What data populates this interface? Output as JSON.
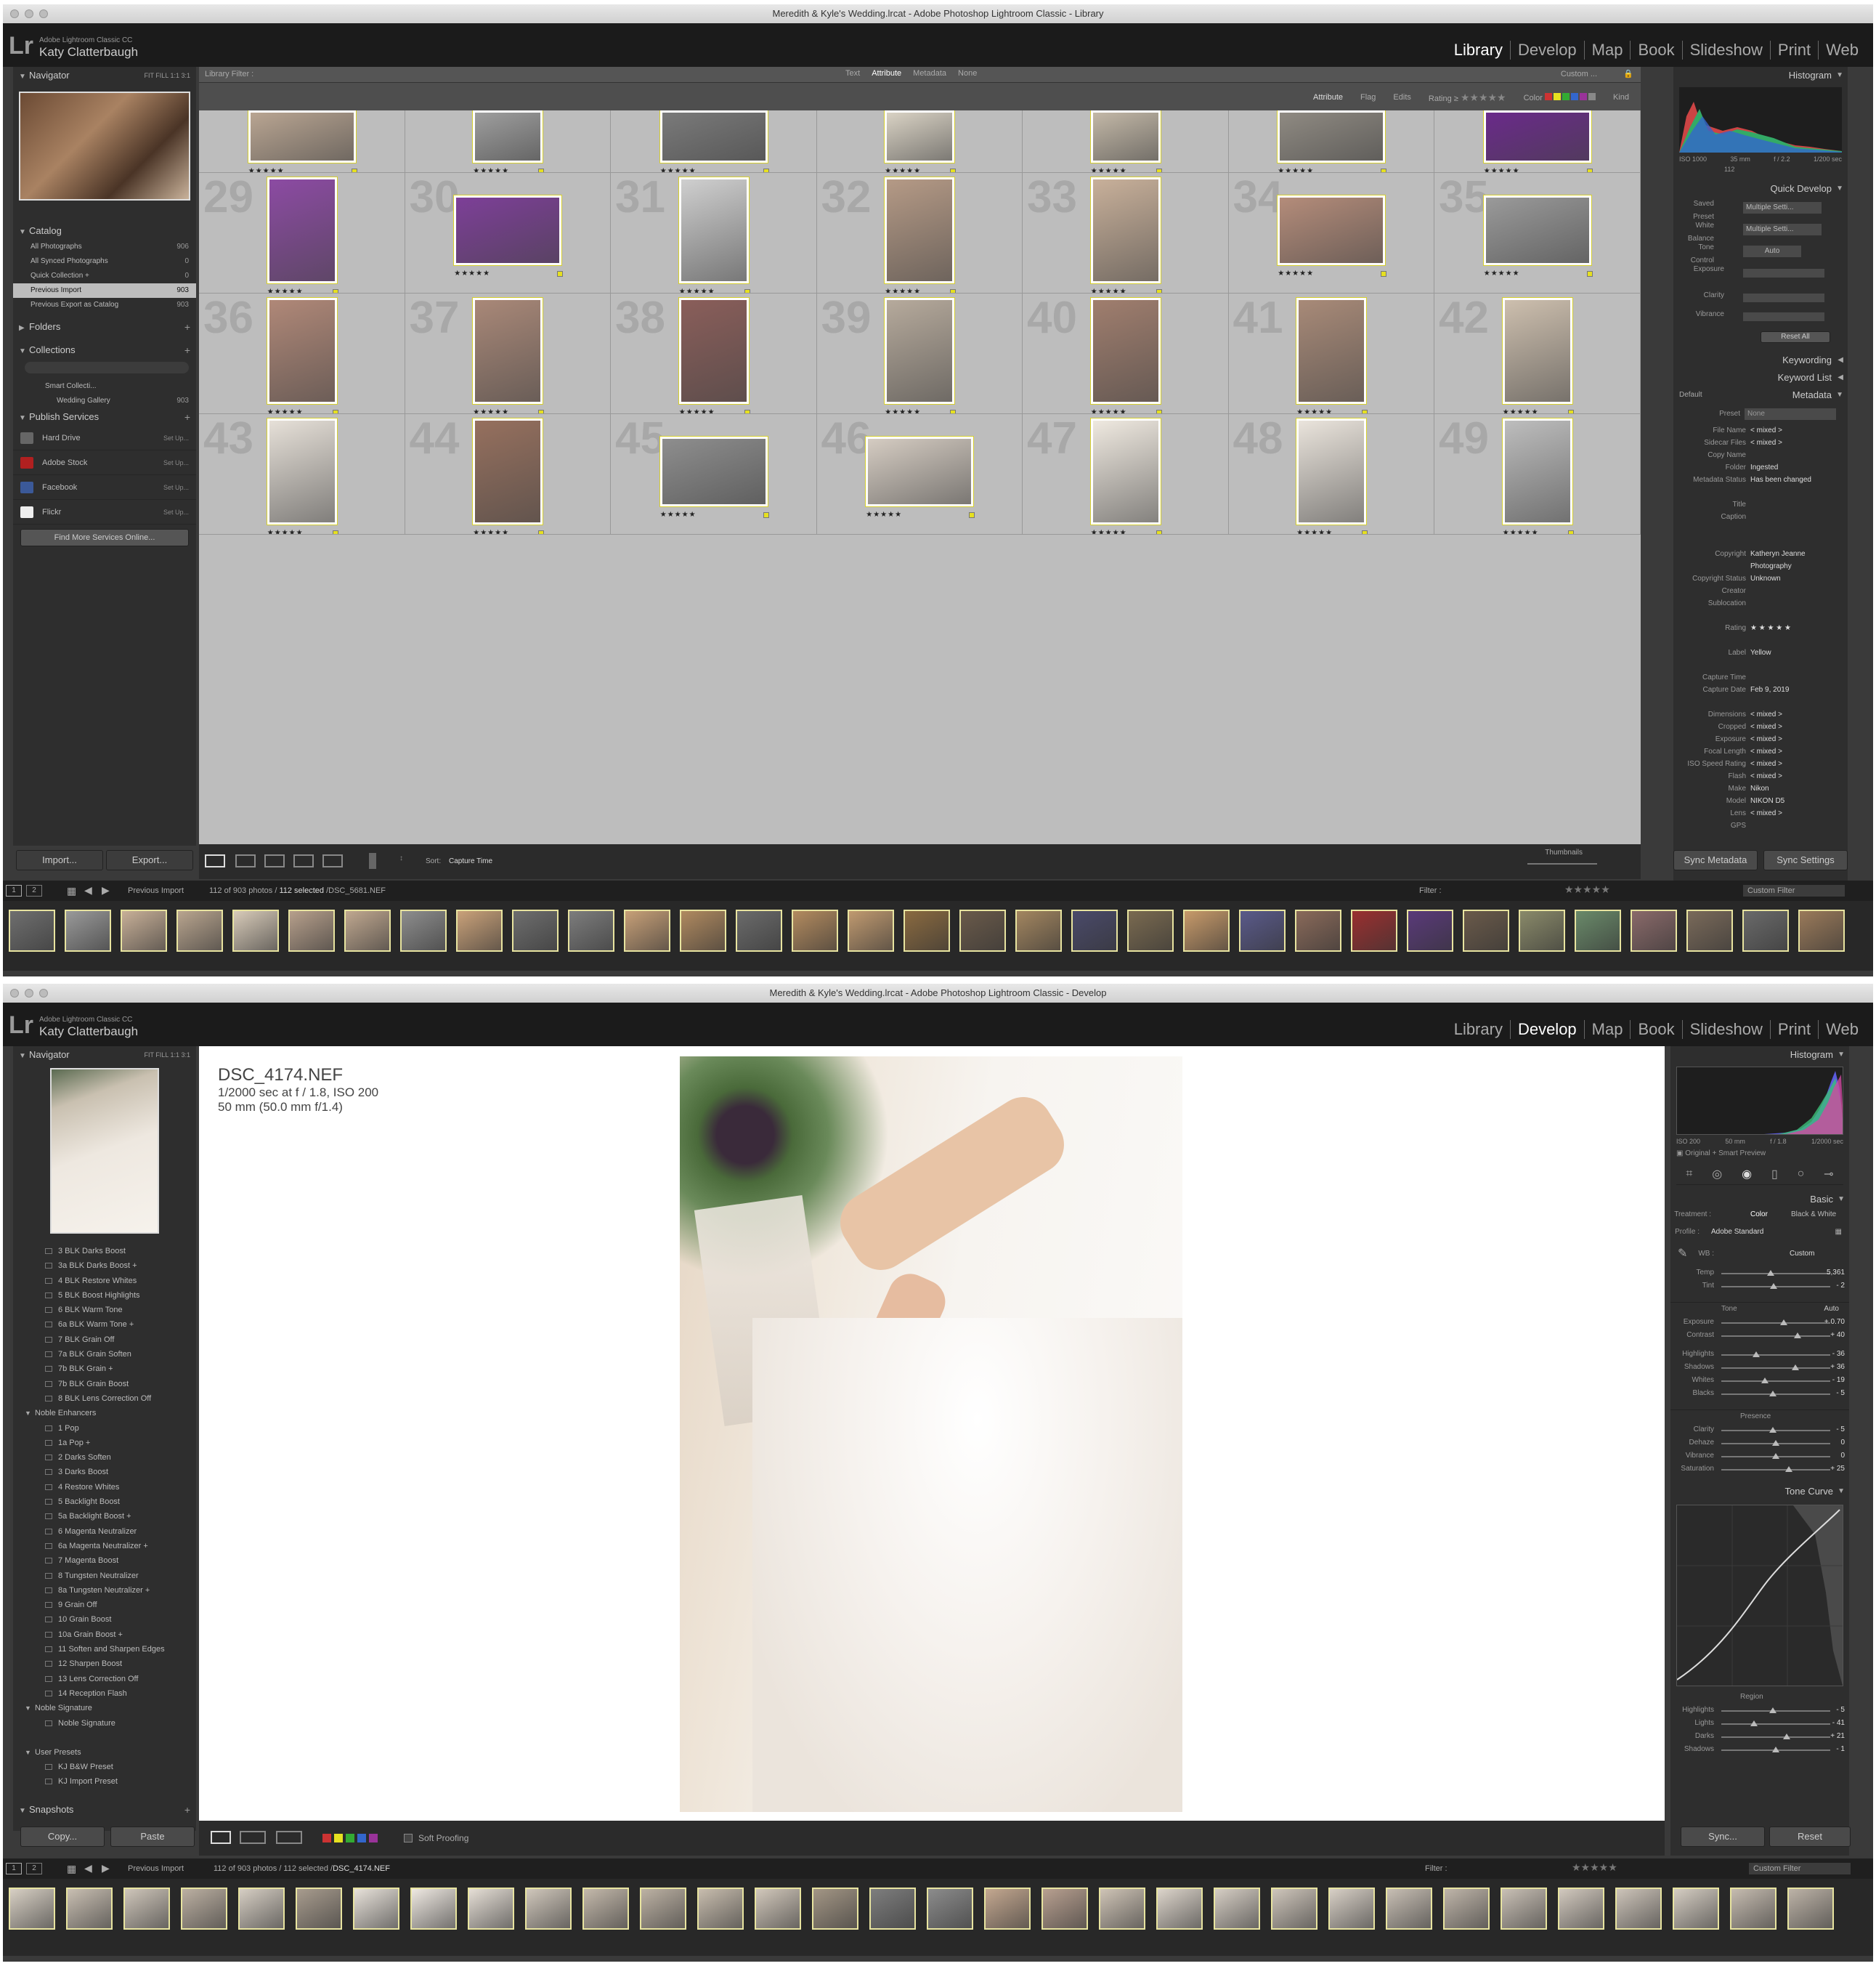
{
  "library": {
    "window_title": "Meredith & Kyle's Wedding.lrcat - Adobe Photoshop Lightroom Classic - Library",
    "brand_small": "Adobe Lightroom Classic CC",
    "brand_name": "Katy Clatterbaugh",
    "modules": [
      "Library",
      "Develop",
      "Map",
      "Book",
      "Slideshow",
      "Print",
      "Web"
    ],
    "active_module": "Library",
    "navigator": {
      "title": "Navigator",
      "zoom": "FIT  FILL  1:1  3:1"
    },
    "catalog": {
      "title": "Catalog",
      "items": [
        {
          "label": "All Photographs",
          "count": "906"
        },
        {
          "label": "All Synced Photographs",
          "count": "0"
        },
        {
          "label": "Quick Collection +",
          "count": "0"
        },
        {
          "label": "Previous Import",
          "count": "903"
        },
        {
          "label": "Previous Export as Catalog",
          "count": "903"
        }
      ]
    },
    "folders": "Folders",
    "collections": {
      "title": "Collections",
      "items": [
        "Smart Collecti...",
        "Wedding Gallery"
      ],
      "gallery_count": "903"
    },
    "publish": {
      "title": "Publish Services",
      "services": [
        {
          "label": "Hard Drive",
          "set": "Set Up...",
          "icon": "hard-drive-icon",
          "color": "#666666"
        },
        {
          "label": "Adobe Stock",
          "set": "Set Up...",
          "icon": "adobe-stock-icon",
          "color": "#b02020"
        },
        {
          "label": "Facebook",
          "set": "Set Up...",
          "icon": "facebook-icon",
          "color": "#3b5998"
        },
        {
          "label": "Flickr",
          "set": "Set Up...",
          "icon": "flickr-icon",
          "color": "#eeeeee"
        }
      ],
      "find_more": "Find More Services Online..."
    },
    "import_btn": "Import...",
    "export_btn": "Export...",
    "filter_bar": {
      "label": "Library Filter :",
      "tabs": [
        "Text",
        "Attribute",
        "Metadata",
        "None"
      ],
      "custom": "Custom ...",
      "attr_label": "Attribute",
      "flag": "Flag",
      "edits": "Edits",
      "rating": "Rating",
      "color": "Color",
      "kind": "Kind"
    },
    "grid_cells": [
      {
        "n": "",
        "stars": "★★★★★",
        "tone": "#b9a592"
      },
      {
        "n": "",
        "stars": "★★★★★",
        "tone": "#9e9e9e"
      },
      {
        "n": "",
        "stars": "★★★★★",
        "tone": "#7a7a7a"
      },
      {
        "n": "",
        "stars": "★★★★★",
        "tone": "#d9d2c4"
      },
      {
        "n": "",
        "stars": "★★★★★",
        "tone": "#c3b8a7"
      },
      {
        "n": "",
        "stars": "★★★★★",
        "tone": "#8f8a82"
      },
      {
        "n": "",
        "stars": "★★★★★",
        "tone": "#6a2a8a"
      },
      {
        "n": "29",
        "stars": "★★★★★",
        "tone": "#8c4ba3"
      },
      {
        "n": "30",
        "stars": "★★★★★",
        "tone": "#7d3f98"
      },
      {
        "n": "31",
        "stars": "★★★★★",
        "tone": "#cfcfcf"
      },
      {
        "n": "32",
        "stars": "★★★★★",
        "tone": "#b59a86"
      },
      {
        "n": "33",
        "stars": "★★★★★",
        "tone": "#c8b09a"
      },
      {
        "n": "34",
        "stars": "★★★★★",
        "tone": "#b48c7a"
      },
      {
        "n": "35",
        "stars": "★★★★★",
        "tone": "#9a9a9a"
      },
      {
        "n": "36",
        "stars": "★★★★★",
        "tone": "#b08878"
      },
      {
        "n": "37",
        "stars": "★★★★★",
        "tone": "#a98878"
      },
      {
        "n": "38",
        "stars": "★★★★★",
        "tone": "#8a5e5a"
      },
      {
        "n": "39",
        "stars": "★★★★★",
        "tone": "#b6aa9c"
      },
      {
        "n": "40",
        "stars": "★★★★★",
        "tone": "#a07e6e"
      },
      {
        "n": "41",
        "stars": "★★★★★",
        "tone": "#a88a78"
      },
      {
        "n": "42",
        "stars": "★★★★★",
        "tone": "#cdbfae"
      },
      {
        "n": "43",
        "stars": "★★★★★",
        "tone": "#e6e0d8"
      },
      {
        "n": "44",
        "stars": "★★★★★",
        "tone": "#96705e"
      },
      {
        "n": "45",
        "stars": "★★★★★",
        "tone": "#8e8e8e"
      },
      {
        "n": "46",
        "stars": "★★★★★",
        "tone": "#d5ccc2"
      },
      {
        "n": "47",
        "stars": "★★★★★",
        "tone": "#efe9e0"
      },
      {
        "n": "48",
        "stars": "★★★★★",
        "tone": "#eae4dc"
      },
      {
        "n": "49",
        "stars": "★★★★★",
        "tone": "#bdbdbd"
      }
    ],
    "sort_label": "Sort:",
    "sort_value": "Capture Time",
    "thumbnails_label": "Thumbnails",
    "histogram": {
      "title": "Histogram",
      "iso": "ISO 1000",
      "mm": "35 mm",
      "f": "f / 2.2",
      "shutter": "1/200 sec",
      "count": "112"
    },
    "quick_develop": {
      "title": "Quick Develop",
      "saved_preset": "Saved Preset",
      "saved_preset_val": "Multiple Setti...",
      "white_balance": "White Balance",
      "white_balance_val": "Multiple Setti...",
      "tone_control": "Tone Control",
      "tone_control_val": "Auto",
      "exposure": "Exposure",
      "clarity": "Clarity",
      "vibrance": "Vibrance",
      "reset": "Reset All"
    },
    "keywording": "Keywording",
    "keyword_list": "Keyword List",
    "metadata": {
      "title": "Metadata",
      "default": "Default",
      "preset": "Preset",
      "preset_val": "None",
      "rows": [
        {
          "k": "File Name",
          "v": "< mixed >"
        },
        {
          "k": "Sidecar Files",
          "v": "< mixed >"
        },
        {
          "k": "Copy Name",
          "v": ""
        },
        {
          "k": "Folder",
          "v": "Ingested"
        },
        {
          "k": "Metadata Status",
          "v": "Has been changed"
        },
        {
          "k": "",
          "v": ""
        },
        {
          "k": "Title",
          "v": ""
        },
        {
          "k": "Caption",
          "v": ""
        },
        {
          "k": "",
          "v": ""
        },
        {
          "k": "",
          "v": ""
        },
        {
          "k": "Copyright",
          "v": "Katheryn Jeanne"
        },
        {
          "k": "",
          "v": "Photography"
        },
        {
          "k": "Copyright Status",
          "v": "Unknown"
        },
        {
          "k": "Creator",
          "v": ""
        },
        {
          "k": "Sublocation",
          "v": ""
        },
        {
          "k": "",
          "v": ""
        },
        {
          "k": "Rating",
          "v": "★ ★ ★ ★ ★"
        },
        {
          "k": "",
          "v": ""
        },
        {
          "k": "Label",
          "v": "Yellow"
        },
        {
          "k": "",
          "v": ""
        },
        {
          "k": "Capture Time",
          "v": ""
        },
        {
          "k": "Capture Date",
          "v": "Feb 9, 2019"
        },
        {
          "k": "",
          "v": ""
        },
        {
          "k": "Dimensions",
          "v": "< mixed >"
        },
        {
          "k": "Cropped",
          "v": "< mixed >"
        },
        {
          "k": "Exposure",
          "v": "< mixed >"
        },
        {
          "k": "Focal Length",
          "v": "< mixed >"
        },
        {
          "k": "ISO Speed Rating",
          "v": "< mixed >"
        },
        {
          "k": "Flash",
          "v": "< mixed >"
        },
        {
          "k": "Make",
          "v": "Nikon"
        },
        {
          "k": "Model",
          "v": "NIKON D5"
        },
        {
          "k": "Lens",
          "v": "< mixed >"
        },
        {
          "k": "GPS",
          "v": ""
        }
      ]
    },
    "sync_metadata": "Sync Metadata",
    "sync_settings": "Sync Settings",
    "status": {
      "source": "Previous Import",
      "count_text": "112 of 903 photos /",
      "selected": "112 selected",
      "file": "/DSC_5681.NEF",
      "filter": "Filter :",
      "custom_filter": "Custom Filter"
    },
    "filmstrip_tones": [
      "#6f6f6f",
      "#9a9a9a",
      "#c8b098",
      "#b9a58f",
      "#d8cbb9",
      "#b7a08c",
      "#c0a890",
      "#8e8e8e",
      "#caa27a",
      "#6e6e6e",
      "#7d7d7d",
      "#c7a078",
      "#b08a60",
      "#6b6b6b",
      "#b38b5f",
      "#c09a70",
      "#8a6a40",
      "#6a5a4a",
      "#a38660",
      "#4a4a6a",
      "#7a6a50",
      "#c79a6a",
      "#5a5a8a",
      "#8a6a5a",
      "#9a3030",
      "#5a3a7a",
      "#6a5a4a",
      "#8a8a6a",
      "#6a8a6a",
      "#8a6a6a",
      "#7a6a5a",
      "#6a6a6a",
      "#9a7a5a"
    ]
  },
  "develop": {
    "window_title": "Meredith & Kyle's Wedding.lrcat - Adobe Photoshop Lightroom Classic - Develop",
    "brand_small": "Adobe Lightroom Classic CC",
    "brand_name": "Katy Clatterbaugh",
    "modules": [
      "Library",
      "Develop",
      "Map",
      "Book",
      "Slideshow",
      "Print",
      "Web"
    ],
    "active_module": "Develop",
    "navigator": {
      "title": "Navigator",
      "zoom": "FIT  FILL  1:1  3:1"
    },
    "presets": [
      {
        "label": "3 BLK Darks Boost",
        "type": "item"
      },
      {
        "label": "3a BLK Darks Boost +",
        "type": "item"
      },
      {
        "label": "4 BLK Restore Whites",
        "type": "item"
      },
      {
        "label": "5 BLK Boost Highlights",
        "type": "item"
      },
      {
        "label": "6 BLK Warm Tone",
        "type": "item"
      },
      {
        "label": "6a BLK Warm Tone +",
        "type": "item"
      },
      {
        "label": "7 BLK Grain Off",
        "type": "item"
      },
      {
        "label": "7a BLK Grain Soften",
        "type": "item"
      },
      {
        "label": "7b BLK Grain +",
        "type": "item"
      },
      {
        "label": "7b BLK Grain Boost",
        "type": "item"
      },
      {
        "label": "8 BLK Lens Correction Off",
        "type": "item"
      },
      {
        "label": "Noble Enhancers",
        "type": "group"
      },
      {
        "label": "1 Pop",
        "type": "item"
      },
      {
        "label": "1a Pop +",
        "type": "item"
      },
      {
        "label": "2 Darks Soften",
        "type": "item"
      },
      {
        "label": "3 Darks Boost",
        "type": "item"
      },
      {
        "label": "4 Restore Whites",
        "type": "item"
      },
      {
        "label": "5 Backlight Boost",
        "type": "item"
      },
      {
        "label": "5a Backlight Boost +",
        "type": "item"
      },
      {
        "label": "6 Magenta Neutralizer",
        "type": "item"
      },
      {
        "label": "6a Magenta Neutralizer +",
        "type": "item"
      },
      {
        "label": "7 Magenta Boost",
        "type": "item"
      },
      {
        "label": "8 Tungsten Neutralizer",
        "type": "item"
      },
      {
        "label": "8a Tungsten Neutralizer +",
        "type": "item"
      },
      {
        "label": "9 Grain Off",
        "type": "item"
      },
      {
        "label": "10 Grain Boost",
        "type": "item"
      },
      {
        "label": "10a Grain Boost +",
        "type": "item"
      },
      {
        "label": "11 Soften and Sharpen Edges",
        "type": "item"
      },
      {
        "label": "12 Sharpen Boost",
        "type": "item"
      },
      {
        "label": "13 Lens Correction Off",
        "type": "item"
      },
      {
        "label": "14 Reception Flash",
        "type": "item"
      },
      {
        "label": "Noble Signature",
        "type": "group"
      },
      {
        "label": "Noble Signature",
        "type": "item"
      },
      {
        "label": "",
        "type": "gap"
      },
      {
        "label": "User Presets",
        "type": "group"
      },
      {
        "label": "KJ B&W Preset",
        "type": "item"
      },
      {
        "label": "KJ Import Preset",
        "type": "item"
      }
    ],
    "snapshots": "Snapshots",
    "copy_btn": "Copy...",
    "paste_btn": "Paste",
    "info": {
      "filename": "DSC_4174.NEF",
      "line2": "1/2000 sec at f / 1.8, ISO 200",
      "line3": "50 mm (50.0 mm f/1.4)"
    },
    "soft_proofing": "Soft Proofing",
    "histogram": {
      "title": "Histogram",
      "iso": "ISO 200",
      "mm": "50 mm",
      "f": "f / 1.8",
      "shutter": "1/2000 sec",
      "preview": "Original + Smart Preview"
    },
    "basic": {
      "title": "Basic",
      "treatment": "Treatment :",
      "color": "Color",
      "bw": "Black & White",
      "profile": "Profile :",
      "profile_val": "Adobe Standard",
      "wb": "WB :",
      "wb_val": "Custom",
      "tone": "Tone",
      "auto": "Auto",
      "presence": "Presence",
      "sliders1": [
        {
          "k": "Temp",
          "v": "5,361",
          "p": 0.45
        },
        {
          "k": "Tint",
          "v": "- 2",
          "p": 0.48
        }
      ],
      "sliders2": [
        {
          "k": "Exposure",
          "v": "+ 0.70",
          "p": 0.57
        },
        {
          "k": "Contrast",
          "v": "+ 40",
          "p": 0.7
        }
      ],
      "sliders3": [
        {
          "k": "Highlights",
          "v": "- 36",
          "p": 0.32
        },
        {
          "k": "Shadows",
          "v": "+ 36",
          "p": 0.68
        },
        {
          "k": "Whites",
          "v": "- 19",
          "p": 0.4
        },
        {
          "k": "Blacks",
          "v": "- 5",
          "p": 0.47
        }
      ],
      "sliders4": [
        {
          "k": "Clarity",
          "v": "- 5",
          "p": 0.47
        },
        {
          "k": "Dehaze",
          "v": "0",
          "p": 0.5
        },
        {
          "k": "Vibrance",
          "v": "0",
          "p": 0.5
        },
        {
          "k": "Saturation",
          "v": "+ 25",
          "p": 0.62
        }
      ]
    },
    "tone_curve": {
      "title": "Tone Curve",
      "region": "Region",
      "sliders": [
        {
          "k": "Highlights",
          "v": "- 5",
          "p": 0.47
        },
        {
          "k": "Lights",
          "v": "- 41",
          "p": 0.3
        },
        {
          "k": "Darks",
          "v": "+ 21",
          "p": 0.6
        },
        {
          "k": "Shadows",
          "v": "- 1",
          "p": 0.5
        }
      ]
    },
    "sync_btn": "Sync...",
    "reset_btn": "Reset",
    "status": {
      "source": "Previous Import",
      "count_text": "112 of 903 photos / 112 selected /",
      "file": "DSC_4174.NEF",
      "filter": "Filter :",
      "custom_filter": "Custom Filter"
    },
    "filmstrip_tones": [
      "#d8d0c4",
      "#c9bfb2",
      "#cfc6ba",
      "#bcb0a2",
      "#d6cec3",
      "#a89c8e",
      "#e8e2da",
      "#efe9e2",
      "#e6dfd6",
      "#d0c7bb",
      "#c4b9ab",
      "#bdb2a4",
      "#c8bdae",
      "#d2c8bb",
      "#a39685",
      "#7e7e7e",
      "#8c8c8c",
      "#c4a890",
      "#b8a090",
      "#cfc4b6",
      "#ddd5cb",
      "#d6cec4",
      "#cfc6bb",
      "#d8d0c6",
      "#c8bfb4",
      "#bfb5a9",
      "#c9c0b5",
      "#d2c9be",
      "#cdc4b9",
      "#d5cdc2",
      "#c6bcb0",
      "#bdb3a7"
    ]
  }
}
